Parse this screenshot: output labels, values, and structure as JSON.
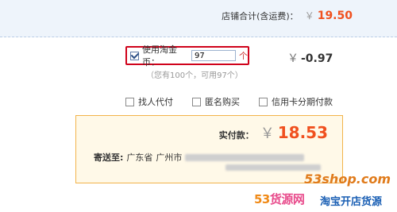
{
  "store_total": {
    "label": "店铺合计(含运费)：",
    "currency": "￥",
    "amount": "19.50"
  },
  "taobao_coin": {
    "checkbox_label": "使用淘金币：",
    "checked": true,
    "input_value": "97",
    "unit": "个",
    "discount_currency": "￥",
    "discount": "-0.97",
    "hint": "（您有100个，可用97个）"
  },
  "options": [
    {
      "label": "找人代付"
    },
    {
      "label": "匿名购买"
    },
    {
      "label": "信用卡分期付款"
    }
  ],
  "payment": {
    "label": "实付款：",
    "currency": "￥",
    "amount": "18.53",
    "ship_label": "寄送至:",
    "ship_province": "广东省",
    "ship_city": "广州市"
  },
  "watermark": {
    "site": "53shop.com",
    "brand_part1": "53",
    "brand_part2": "货源网",
    "slogan": "淘宝开店货源"
  },
  "colors": {
    "accent": "#f0501e",
    "highlight_border": "#d0021b",
    "pay_box_border": "#f2b34a"
  }
}
